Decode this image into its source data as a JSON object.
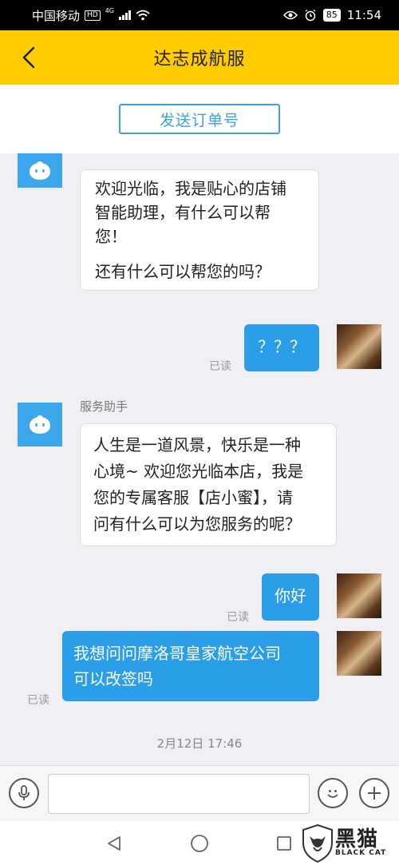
{
  "status_bar": {
    "carrier": "中国移动",
    "hd": "HD",
    "network": "4G",
    "battery": "85",
    "time": "11:54"
  },
  "header": {
    "title": "达志成航服"
  },
  "order": {
    "button_label": "发送订单号"
  },
  "messages": {
    "m1": {
      "line1": "欢迎光临，我是贴心的店铺",
      "line2": "智能助理，有什么可以帮",
      "line3": "您！",
      "line4": "还有什么可以帮您的吗？"
    },
    "m2": {
      "text": "？？？",
      "status": "已读"
    },
    "m3": {
      "sender": "服务助手",
      "line1": "人生是一道风景，快乐是一种",
      "line2": "心境~ 欢迎您光临本店，我是",
      "line3": "您的专属客服【店小蜜】，请",
      "line4": "问有什么可以为您服务的呢？"
    },
    "m4": {
      "text": "你好",
      "status": "已读"
    },
    "m5": {
      "line1": "我想问问摩洛哥皇家航空公司",
      "line2": "可以改签吗",
      "status": "已读"
    }
  },
  "timestamp": "2月12日 17:46",
  "input": {
    "value": "",
    "placeholder": ""
  },
  "watermark": {
    "cn": "黑猫",
    "en": "BLACK CAT"
  },
  "colors": {
    "header_bg": "#ffcc00",
    "bubble_right": "#2a9ee8",
    "bot_avatar": "#3ca6ea",
    "order_button": "#3aa3e0"
  },
  "icons": {
    "back": "chevron-left-icon",
    "voice": "microphone-icon",
    "emoji": "smiley-icon",
    "more": "plus-icon",
    "nav_back": "triangle-back-icon",
    "nav_home": "circle-home-icon",
    "nav_recent": "square-recent-icon"
  }
}
